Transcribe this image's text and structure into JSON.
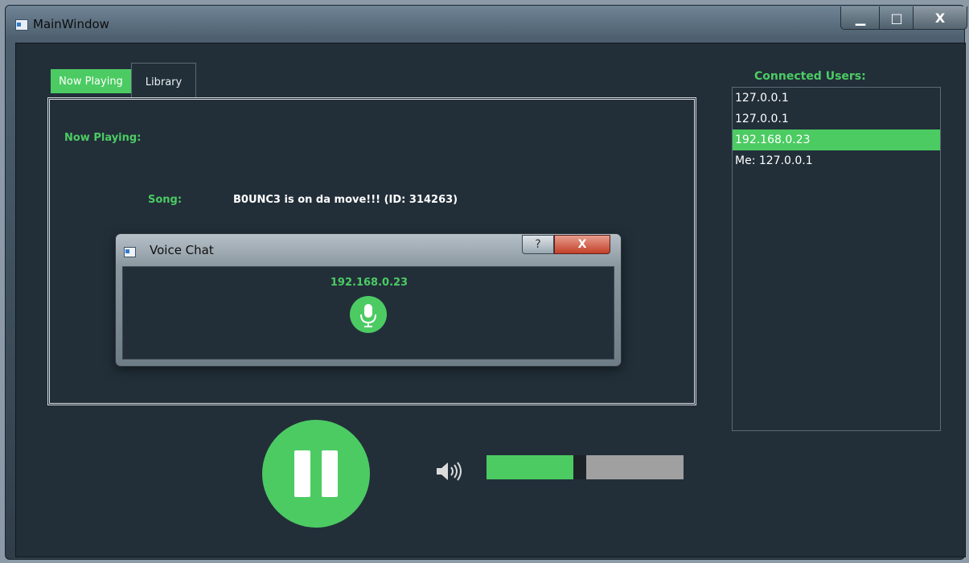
{
  "window": {
    "title": "MainWindow",
    "minimize_glyph": "▁",
    "maximize_glyph": "□",
    "close_glyph": "X"
  },
  "tabs": [
    {
      "label": "Now Playing",
      "active": true
    },
    {
      "label": "Library",
      "active": false
    }
  ],
  "now_playing": {
    "heading": "Now Playing:",
    "song_label": "Song:",
    "song_title": "B0UNC3 is on da move!!! (ID: 314263)"
  },
  "transport": {
    "state_icon": "pause-icon",
    "volume_level": 0.47
  },
  "users": {
    "heading": "Connected Users:",
    "items": [
      {
        "label": "127.0.0.1",
        "selected": false
      },
      {
        "label": "127.0.0.1",
        "selected": false
      },
      {
        "label": "192.168.0.23",
        "selected": true
      },
      {
        "label": "Me: 127.0.0.1",
        "selected": false
      }
    ]
  },
  "voice_chat": {
    "title": "Voice Chat",
    "help_glyph": "?",
    "close_glyph": "X",
    "peer_ip": "192.168.0.23",
    "mic_icon": "microphone-icon"
  },
  "colors": {
    "accent": "#4ccb63",
    "background": "#222f39",
    "text": "#ffffff",
    "slider_track": "#a0a0a0"
  }
}
